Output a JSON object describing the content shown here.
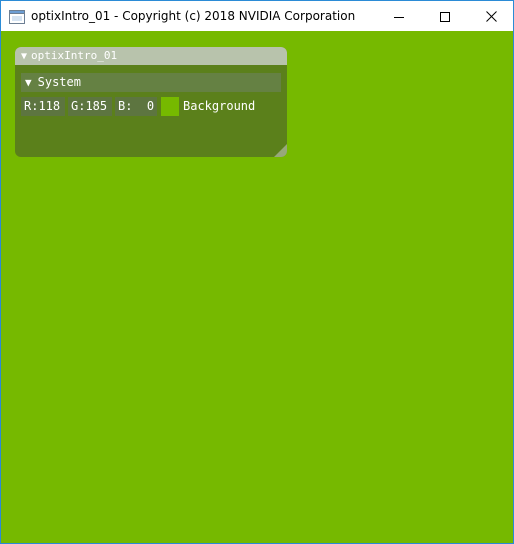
{
  "window": {
    "title": "optixIntro_01 - Copyright (c) 2018 NVIDIA Corporation",
    "accent_border": "#2b8bd6"
  },
  "icons": {
    "app": "app-window-icon",
    "minimize": "minimize-icon",
    "maximize": "maximize-icon",
    "close": "close-icon",
    "collapse": "triangle-down-icon",
    "resize": "resize-grip-icon"
  },
  "scene": {
    "background_color": "#76b900"
  },
  "panel": {
    "title": "optixIntro_01",
    "section": {
      "label": "System",
      "fields": {
        "r": "R:118",
        "g": "G:185",
        "b": "B:  0"
      },
      "swatch_color": "#76b900",
      "color_label": "Background"
    }
  }
}
